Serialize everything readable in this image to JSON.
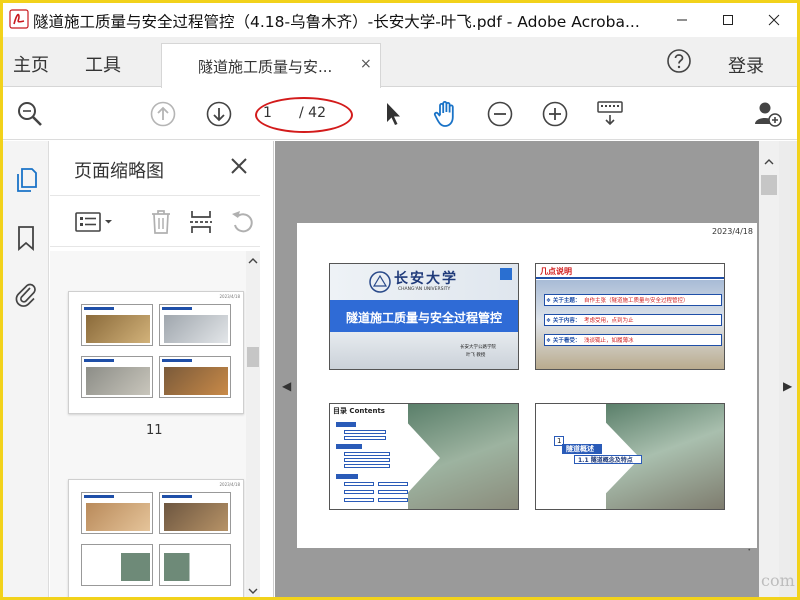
{
  "window": {
    "title": "隧道施工质量与安全过程管控（4.18-乌鲁木齐）-长安大学-叶飞.pdf - Adobe Acroba...",
    "min_icon": "minimize-icon",
    "max_icon": "maximize-icon",
    "close_icon": "close-icon"
  },
  "nav": {
    "home": "主页",
    "tools": "工具",
    "doc_tab": "隧道施工质量与安...",
    "doc_tab_close": "×",
    "login": "登录"
  },
  "toolbar": {
    "page_current": "1",
    "page_total": "/ 42"
  },
  "panel": {
    "title": "页面缩略图",
    "thumb_label_1": "11"
  },
  "document": {
    "date": "2023/4/18",
    "slide1": {
      "logo_text": "长安大学",
      "logo_sub": "CHANG'AN UNIVERSITY",
      "title": "隧道施工质量与安全过程管控",
      "author_line1": "长安大学公路学院",
      "author_line2": "叶飞 教授"
    },
    "slide2": {
      "heading": "几点说明",
      "item1_label": "❖ 关于主题：",
      "item1_text": "自作主张（隧道施工质量与安全过程管控）",
      "item2_label": "❖ 关于内容：",
      "item2_text": "考虑受用，点到为止",
      "item3_label": "❖ 关于看受：",
      "item3_text": "浅谈辄止，如履薄冰"
    },
    "slide3": {
      "heading": "目录  Contents"
    },
    "slide4": {
      "num": "1",
      "title": "隧道概述",
      "sub": "1.1 隧道概念及特点"
    }
  },
  "watermark": "com",
  "colors": {
    "accent_blue": "#1f4fa8",
    "highlight_oval": "#d31b1b",
    "frame": "#f2d21b",
    "hand_tool": "#1a73c7"
  }
}
